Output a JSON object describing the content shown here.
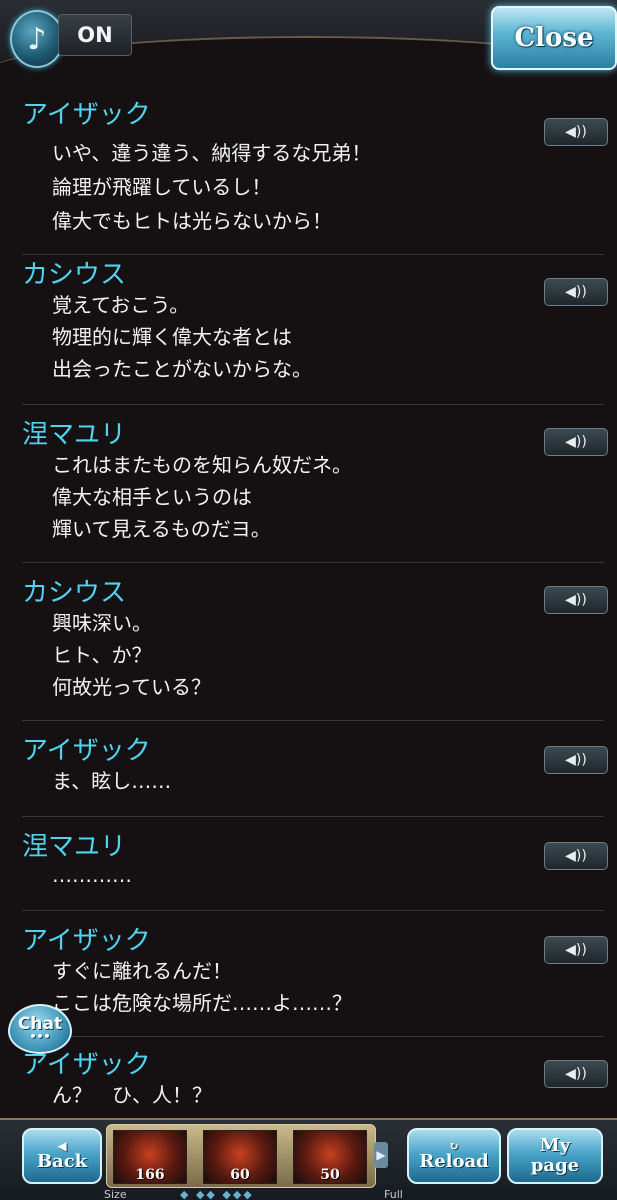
{
  "header": {
    "music_icon": "music-note-icon",
    "music_glyph": "♪",
    "music_state": "ON",
    "close_label": "Close"
  },
  "log": [
    {
      "name": "アイザック",
      "lines": [
        "いや、違う違う、納得するな兄弟！",
        "論理が飛躍しているし！",
        "偉大でもヒトは光らないから！"
      ]
    },
    {
      "name": "カシウス",
      "lines": [
        "覚えておこう。",
        "物理的に輝く偉大な者とは",
        "出会ったことがないからな。"
      ]
    },
    {
      "name": "涅マユリ",
      "lines": [
        "これはまたものを知らん奴だネ。",
        "偉大な相手というのは",
        "輝いて見えるものだヨ。"
      ]
    },
    {
      "name": "カシウス",
      "lines": [
        "興味深い。",
        "ヒト、か？",
        "何故光っている？"
      ]
    },
    {
      "name": "アイザック",
      "lines": [
        "ま、眩し……"
      ]
    },
    {
      "name": "涅マユリ",
      "lines": [
        "…………"
      ]
    },
    {
      "name": "アイザック",
      "lines": [
        "すぐに離れるんだ！",
        "ここは危険な場所だ……よ……？"
      ]
    },
    {
      "name": "アイザック",
      "lines": [
        "ん？　ひ、人！？"
      ]
    }
  ],
  "voice_button": {
    "icon": "speaker-icon",
    "glyph": "◀))"
  },
  "chat": {
    "label": "Chat",
    "dots": "•••"
  },
  "footer": {
    "back_label": "Back",
    "back_glyph": "◀",
    "reload_label": "Reload",
    "reload_glyph": "↻",
    "mypage_line1": "My",
    "mypage_line2": "page",
    "slots": [
      {
        "count": "166"
      },
      {
        "count": "60"
      },
      {
        "count": "50"
      }
    ],
    "arrow_glyph": "▶",
    "size_label": "Size",
    "size_marks": "◆  ◆◆  ◆◆◆",
    "full_label": "Full"
  }
}
